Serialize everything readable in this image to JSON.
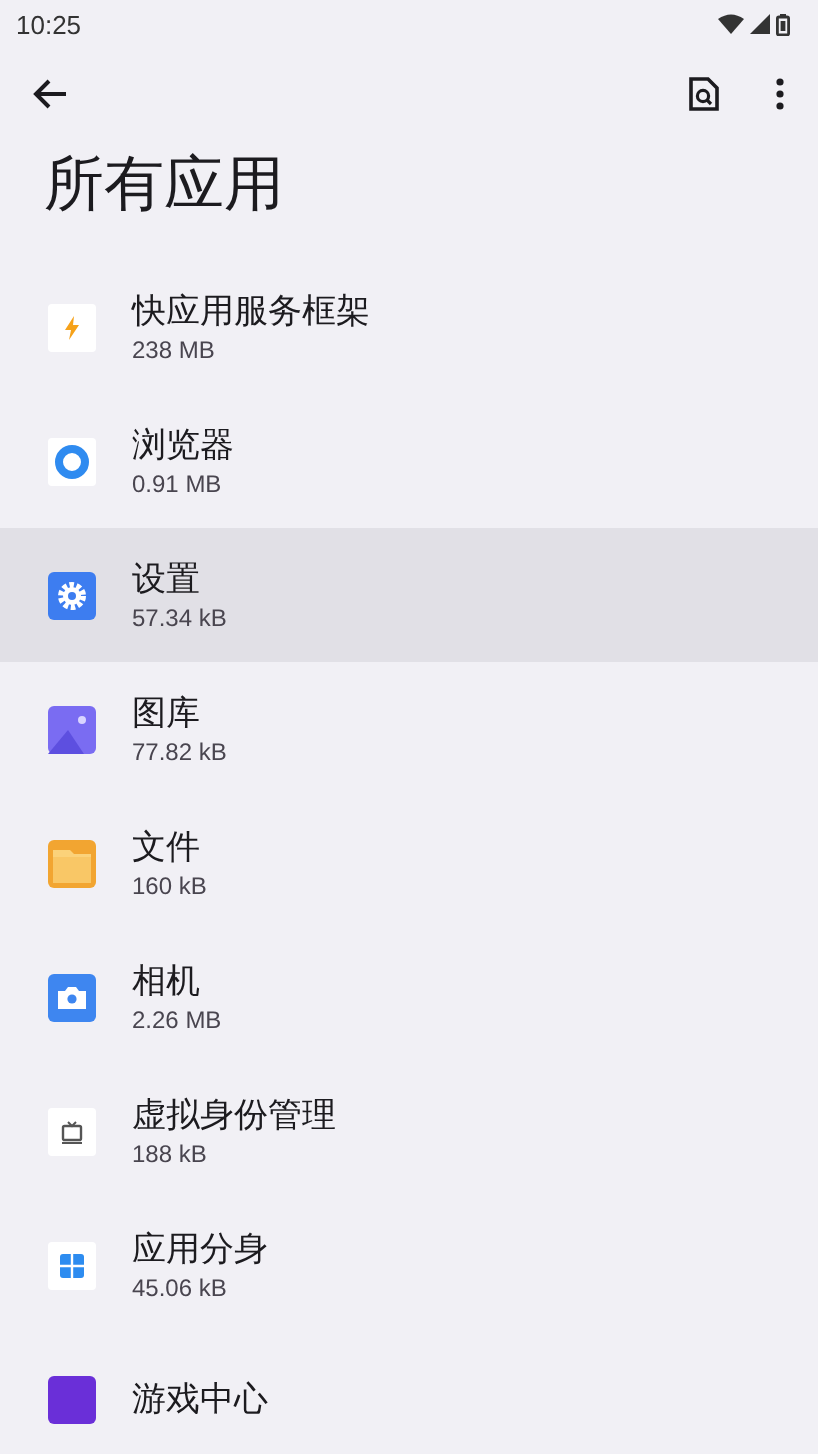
{
  "status_bar": {
    "time": "10:25"
  },
  "title": "所有应用",
  "apps": [
    {
      "name": "快应用服务框架",
      "size": "238 MB",
      "kind": "bolt",
      "selected": false
    },
    {
      "name": "浏览器",
      "size": "0.91 MB",
      "kind": "ring",
      "selected": false
    },
    {
      "name": "设置",
      "size": "57.34 kB",
      "kind": "gear",
      "selected": true
    },
    {
      "name": "图库",
      "size": "77.82 kB",
      "kind": "gallery",
      "selected": false
    },
    {
      "name": "文件",
      "size": "160 kB",
      "kind": "folder",
      "selected": false
    },
    {
      "name": "相机",
      "size": "2.26 MB",
      "kind": "camera",
      "selected": false
    },
    {
      "name": "虚拟身份管理",
      "size": "188 kB",
      "kind": "tv",
      "selected": false
    },
    {
      "name": "应用分身",
      "size": "45.06 kB",
      "kind": "grid",
      "selected": false
    },
    {
      "name": "游戏中心",
      "kind": "game",
      "selected": false
    }
  ]
}
